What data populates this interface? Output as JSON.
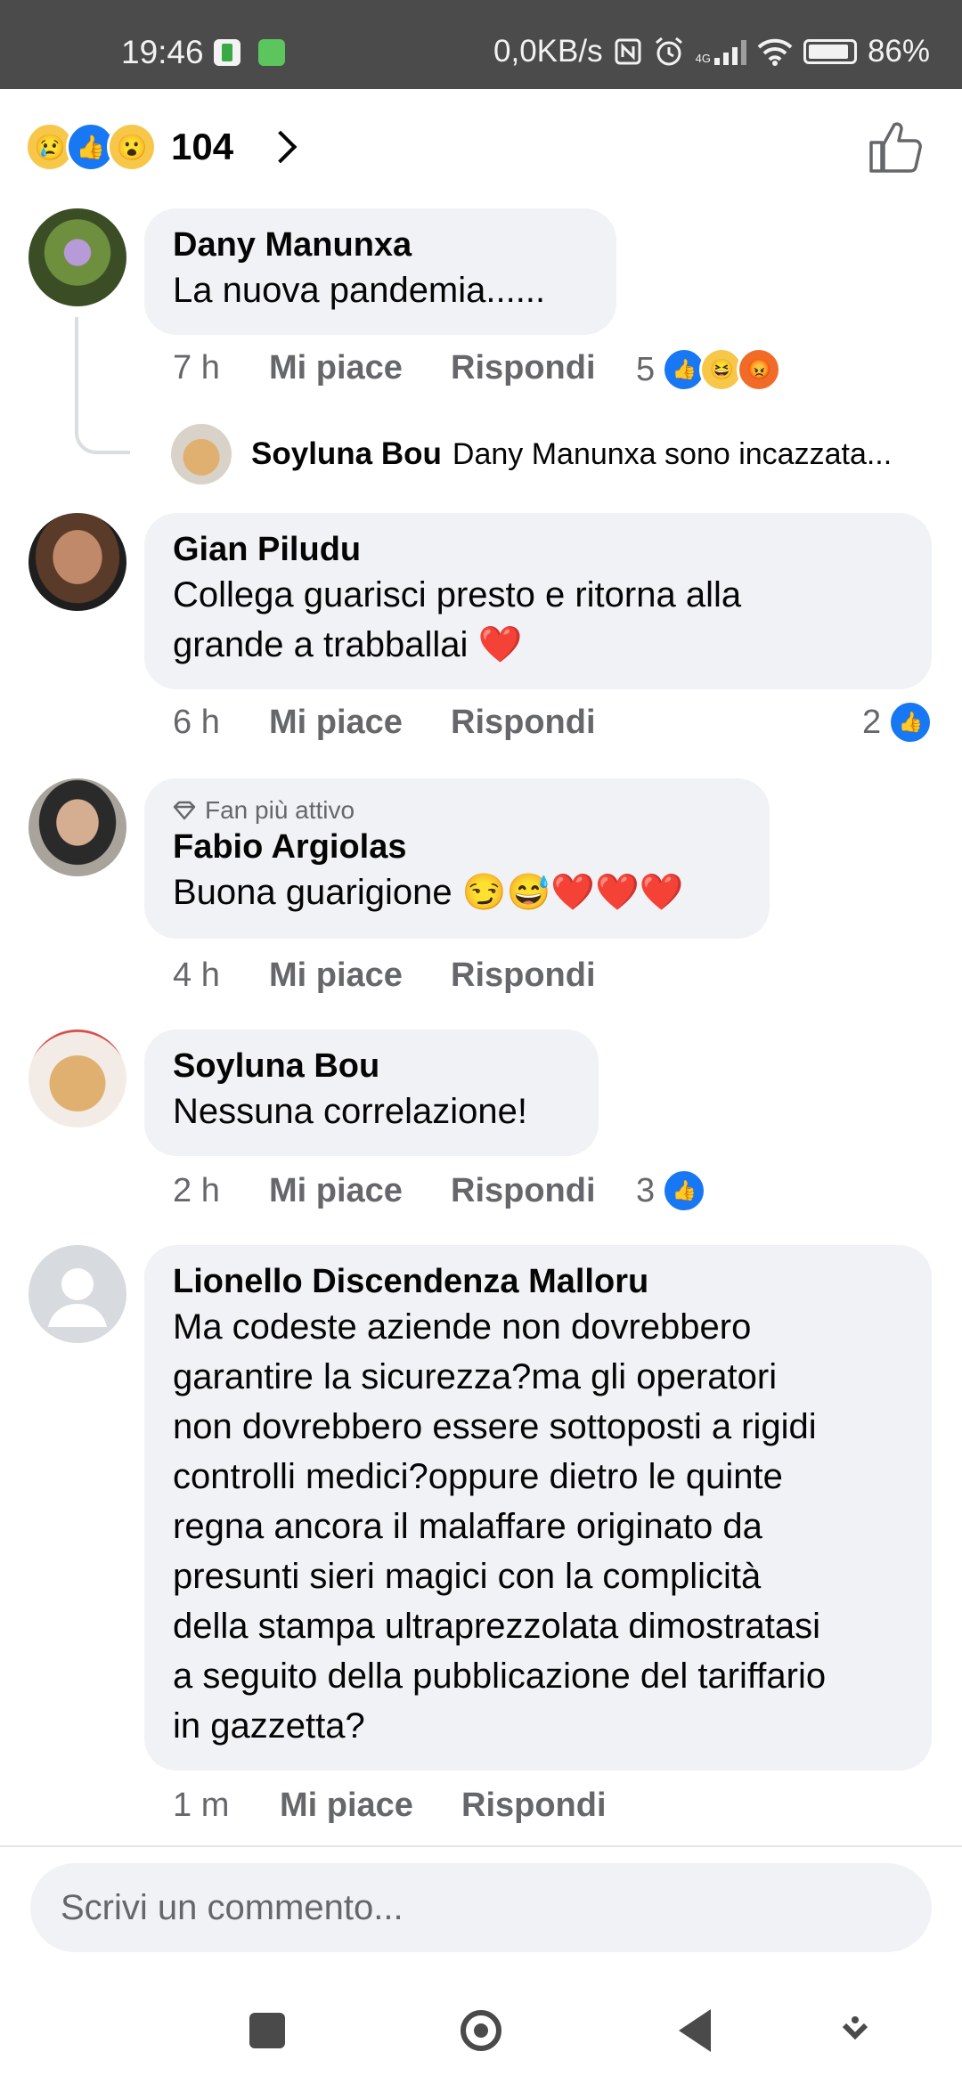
{
  "status_bar": {
    "time": "19:46",
    "network_speed": "0,0KB/s",
    "network_type": "4G",
    "battery": "86%",
    "icons": [
      "app-notification-icon",
      "android-icon",
      "nfc-icon",
      "alarm-icon",
      "signal-icon",
      "wifi-icon",
      "battery-icon"
    ]
  },
  "reactions_header": {
    "emojis": [
      "sad-emoji",
      "like-emoji",
      "wow-emoji"
    ],
    "count": "104"
  },
  "comments": [
    {
      "author": "Dany Manunxa",
      "text": "La nuova pandemia......",
      "time": "7 h",
      "like_label": "Mi piace",
      "reply_label": "Rispondi",
      "reaction_count": "5",
      "reactions": [
        "like",
        "haha",
        "angry"
      ],
      "reply": {
        "author": "Soyluna Bou",
        "preview": "Dany Manunxa sono incazzata..."
      }
    },
    {
      "author": "Gian Piludu",
      "text_line1": "Collega guarisci presto e ritorna alla",
      "text_line2": "grande a trabballai ❤️",
      "time": "6 h",
      "like_label": "Mi piace",
      "reply_label": "Rispondi",
      "reaction_count": "2",
      "reactions": [
        "like"
      ]
    },
    {
      "badge": "Fan più attivo",
      "author": "Fabio Argiolas",
      "text": "Buona guarigione 😏😅❤️❤️❤️",
      "time": "4 h",
      "like_label": "Mi piace",
      "reply_label": "Rispondi"
    },
    {
      "author": "Soyluna Bou",
      "text": "Nessuna correlazione!",
      "time": "2 h",
      "like_label": "Mi piace",
      "reply_label": "Rispondi",
      "reaction_count": "3",
      "reactions": [
        "like"
      ]
    },
    {
      "author": "Lionello Discendenza Malloru",
      "lines": [
        "Ma codeste aziende non dovrebbero",
        "garantire la sicurezza?ma gli operatori",
        "non dovrebbero essere sottoposti a rigidi",
        "controlli medici?oppure dietro le quinte",
        "regna ancora il malaffare originato da",
        "presunti sieri magici con la complicità",
        "della stampa ultraprezzolata dimostratasi",
        "a seguito della pubblicazione del tariffario",
        "in gazzetta?"
      ],
      "time": "1 m",
      "like_label": "Mi piace",
      "reply_label": "Rispondi"
    }
  ],
  "composer": {
    "placeholder": "Scrivi un commento..."
  },
  "colors": {
    "bubble": "#f0f2f5",
    "like_blue": "#1877f2",
    "meta_gray": "#65676b",
    "status_bar": "#4b4b4b"
  }
}
